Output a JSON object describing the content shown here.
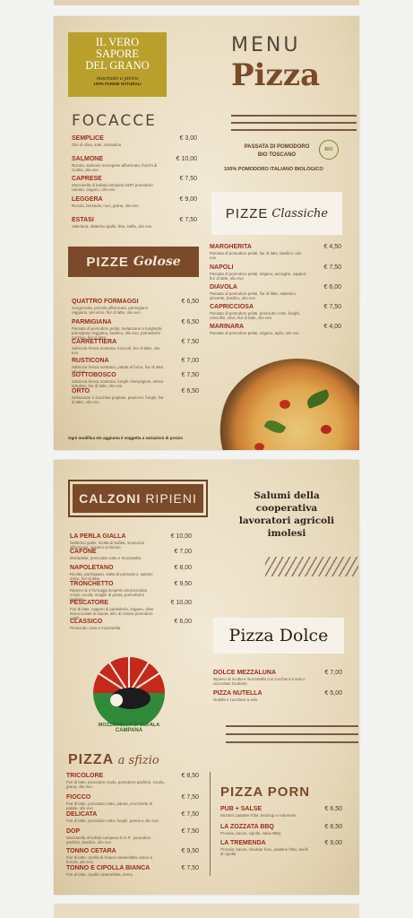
{
  "header": {
    "brand_line1": "IL VERO",
    "brand_line2": "SAPORE",
    "brand_line3": "DEL GRANO",
    "brand_tag1": "macinato a pietra",
    "brand_tag2": "100% FARINE NATURALI",
    "menu_word": "MENU",
    "pizza_word": "Pizza",
    "passata1": "PASSATA DI POMODORO",
    "passata2": "BIO TOSCANO",
    "bio_badge": "BIO",
    "passata_note": "100% POMODORO ITALIANO BIOLOGICO"
  },
  "focacce": {
    "title": "FOCACCE",
    "items": [
      {
        "name": "SEMPLICE",
        "desc": "Olio di oliva, sale, rosmarino",
        "price": "€ 3,00"
      },
      {
        "name": "SALMONE",
        "desc": "Rucola, salmone norvegese affumicato, fiocchi di ricotta, olio evo",
        "price": "€ 10,00"
      },
      {
        "name": "CAPRESE",
        "desc": "Mozzarella di bufala campana DOP, pomodoro ramato, origano, olio evo",
        "price": "€ 7,50"
      },
      {
        "name": "LEGGERA",
        "desc": "Rucola, bresaola, noci, grana, olio evo",
        "price": "€ 9,00"
      },
      {
        "name": "ESTASI",
        "desc": "Valeriana, datterino giallo, feta, stella, olio evo",
        "price": "€ 7,50"
      }
    ]
  },
  "golose": {
    "title1": "PIZZE",
    "title2": "Golose",
    "items": [
      {
        "name": "QUATTRO FORMAGGI",
        "desc": "Gorgonzola, provola affumicata, parmigiano reggiano, pecorino, fior di latte, olio evo",
        "price": "€ 6,50"
      },
      {
        "name": "PARMIGIANA",
        "desc": "Passata di pomodoro pelati, melanzane a funghetto, parmigiano reggiano, basilico, olio evo, pomodorini pachino, fior di latte",
        "price": "€ 6,50"
      },
      {
        "name": "CARRETTIERA",
        "desc": "Salsiccia fresca nostrana, broccoli, fior di latte, olio evo",
        "price": "€ 7,50"
      },
      {
        "name": "RUSTICONA",
        "desc": "Salsiccia fresca nostrana, patate al forno, fior di latte, olio evo",
        "price": "€ 7,00"
      },
      {
        "name": "SOTTOBOSCO",
        "desc": "Salsiccia fresca nostrana, funghi champignon, sesso tartufato, fior di latte, olio evo",
        "price": "€ 7,50"
      },
      {
        "name": "ORTO",
        "desc": "Melanzane e zucchine grigliate, peperoni, funghi, fior di latte, olio evo",
        "price": "€ 6,50"
      }
    ],
    "footnote": "Ogni modifica e/o aggiunta è soggetta a variazioni di prezzo"
  },
  "classiche": {
    "title1": "PIZZE",
    "title2": "Classiche",
    "items": [
      {
        "name": "MARGHERITA",
        "desc": "Passata di pomodoro pelati, fior di latte, basilico, olio evo",
        "price": "€ 4,50"
      },
      {
        "name": "NAPOLI",
        "desc": "Passata di pomodoro pelati, origano, acciughe, capperi, fior di latte, olio evo",
        "price": "€ 7,50"
      },
      {
        "name": "DIAVOLA",
        "desc": "Passata di pomodoro pelati, fior di latte, salamino piccante, basilico, olio evo",
        "price": "€ 6,00"
      },
      {
        "name": "CAPRICCIOSA",
        "desc": "Passata di pomodoro pelati, prosciutto cotto, funghi, carciofini, olive, fior di latte, olio evo",
        "price": "€ 7,50"
      },
      {
        "name": "MARINARA",
        "desc": "Passata di pomodoro pelati, origano, aglio, olio evo",
        "price": "€ 4,00"
      }
    ]
  },
  "calzoni": {
    "title1": "CALZONI",
    "title2": "RIPIENI",
    "items": [
      {
        "name": "LA PERLA GIALLA",
        "desc": "Datterino giallo, ricotta di bufala, scamorza affumicata, sesamo al limone",
        "price": "€ 10,00"
      },
      {
        "name": "CAFONE",
        "desc": "Mortadella, prosciutto cotto e mozzarella",
        "price": "€ 7,00"
      },
      {
        "name": "NAPOLETANO",
        "desc": "Ricotta, parmigiano, salsa di pomodoro, salame dolce, fior di latte",
        "price": "€ 8,00"
      },
      {
        "name": "TRONCHETTO",
        "desc": "Ripieno ai 4 formaggi ricoperto da prosciutto crudo, rucola, scaglie di grana, pomodorini pachino",
        "price": "€ 9,50"
      },
      {
        "name": "PESCATORE",
        "desc": "Fior di latte, capperi di pantelleria, origano, olive denocciolate di Gaeta, alici di Cetara pomodoro confit",
        "price": "€ 10,00"
      },
      {
        "name": "CLASSICO",
        "desc": "Prosciutto cotto e mozzarella",
        "price": "€ 6,00"
      }
    ]
  },
  "salumi": {
    "line1": "Salumi della",
    "line2": "cooperativa",
    "line3": "lavoratori agricoli",
    "line4": "imolesi"
  },
  "dolce": {
    "title": "Pizza Dolce",
    "items": [
      {
        "name": "DOLCE MEZZALUNA",
        "desc": "Ripieno di ricotta e mozzarella con zucchero a velo e cioccolato fondente",
        "price": "€ 7,00"
      },
      {
        "name": "PIZZA NUTELLA",
        "desc": "Nutella e zucchero a velo",
        "price": "€ 5,00"
      }
    ]
  },
  "logo": {
    "text1": "MOZZARELLA DI BUFALA",
    "text2": "CAMPANA"
  },
  "sfizio": {
    "title1": "PIZZA",
    "title2": "a sfizio",
    "items": [
      {
        "name": "TRICOLORE",
        "desc": "Fior di latte, prosciutto crudo, pomodoro pachino, rucola, grana, olio evo",
        "price": "€ 8,50"
      },
      {
        "name": "FIOCCO",
        "desc": "Fior di latte, prosciutto cotto, panna, crocchette di patate, olio evo",
        "price": "€ 7,50"
      },
      {
        "name": "DELICATA",
        "desc": "Fior di latte, prosciutto cotto, funghi, panna e olio evo",
        "price": "€ 7,50"
      },
      {
        "name": "DOP",
        "desc": "Mozzarella di bufala campana D.O.P., pomodoro pachino, basilico, olio evo",
        "price": "€ 7,50"
      },
      {
        "name": "TONNO CETARA",
        "desc": "Fior di latte, cipolla di tropea caramellata, tonno a fiocchi, olio evo",
        "price": "€ 9,50"
      },
      {
        "name": "TONNO E CIPOLLA BIANCA",
        "desc": "Fior di latte, cipolla caramellata, tonno",
        "price": "€ 7,50"
      }
    ]
  },
  "porn": {
    "title1": "PIZZA",
    "title2": "PORN",
    "items": [
      {
        "name": "PUB + SALSE",
        "desc": "Wurstel, patatine fritte, ketchup e maionese",
        "price": "€ 6,50"
      },
      {
        "name": "LA ZOZZATA BBQ",
        "desc": "Provola, bacon, cipolla, salsa BBQ",
        "price": "€ 8,50"
      },
      {
        "name": "LA TREMENDA",
        "desc": "Provola, bacon, cheddar fuso, patatine fritte, anelli di cipolla",
        "price": "€ 9,00"
      }
    ]
  }
}
